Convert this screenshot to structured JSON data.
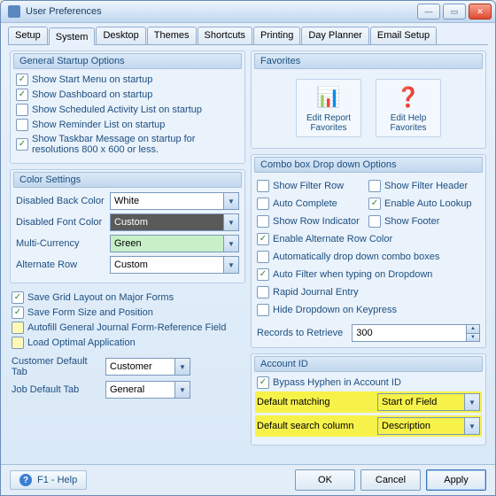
{
  "window": {
    "title": "User Preferences"
  },
  "tabs": [
    "Setup",
    "System",
    "Desktop",
    "Themes",
    "Shortcuts",
    "Printing",
    "Day Planner",
    "Email Setup"
  ],
  "startup": {
    "header": "General Startup Options",
    "items": [
      {
        "label": "Show Start Menu on startup",
        "checked": true
      },
      {
        "label": "Show Dashboard on startup",
        "checked": true
      },
      {
        "label": "Show Scheduled Activity List on startup",
        "checked": false
      },
      {
        "label": "Show Reminder List on startup",
        "checked": false
      },
      {
        "label": "Show Taskbar Message on startup for resolutions 800 x 600 or less.",
        "checked": true
      }
    ]
  },
  "color": {
    "header": "Color Settings",
    "rows": [
      {
        "label": "Disabled Back Color",
        "value": "White"
      },
      {
        "label": "Disabled Font Color",
        "value": "Custom"
      },
      {
        "label": "Multi-Currency",
        "value": "Green"
      },
      {
        "label": "Alternate Row",
        "value": "Custom"
      }
    ]
  },
  "misc": {
    "items": [
      "Save Grid Layout on Major Forms",
      "Save Form Size and Position",
      "Autofill General Journal Form-Reference Field",
      "Load Optimal Application"
    ]
  },
  "defaults": [
    {
      "label": "Customer Default Tab",
      "value": "Customer"
    },
    {
      "label": "Job Default Tab",
      "value": "General"
    }
  ],
  "favorites": {
    "header": "Favorites",
    "items": [
      "Edit Report Favorites",
      "Edit Help Favorites"
    ]
  },
  "combo": {
    "header": "Combo box Drop down Options",
    "items": [
      "Show Filter Row",
      "Show Filter Header",
      "Auto Complete",
      "Enable Auto Lookup",
      "Show Row Indicator",
      "Show Footer",
      "Enable Alternate Row Color",
      "Automatically drop down combo boxes",
      "Auto Filter when typing on Dropdown",
      "Rapid Journal Entry",
      "Hide Dropdown on Keypress"
    ],
    "records_label": "Records to Retrieve",
    "records_value": "300"
  },
  "account": {
    "header": "Account ID",
    "bypass": "Bypass Hyphen in Account ID",
    "rows": [
      {
        "label": "Default matching",
        "value": "Start of Field"
      },
      {
        "label": "Default search column",
        "value": "Description"
      }
    ]
  },
  "footer": {
    "help": "F1 - Help",
    "ok": "OK",
    "cancel": "Cancel",
    "apply": "Apply"
  }
}
